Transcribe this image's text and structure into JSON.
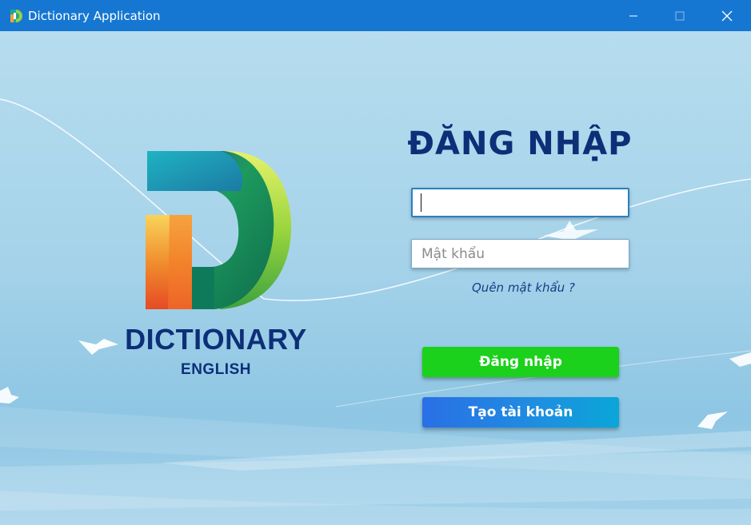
{
  "window": {
    "title": "Dictionary Application",
    "icons": {
      "app": "dictionary-d-logo-icon",
      "minimize": "minimize-icon",
      "maximize": "maximize-icon",
      "close": "close-icon"
    }
  },
  "brand": {
    "name": "DICTIONARY",
    "subtitle": "ENGLISH",
    "logo_icon": "dictionary-d-logo-icon"
  },
  "login": {
    "heading": "ĐĂNG NHẬP",
    "username": {
      "value": "",
      "placeholder": ""
    },
    "password": {
      "value": "",
      "placeholder": "Mật khẩu"
    },
    "forgot_link": "Quên mật khẩu ?",
    "login_button": "Đăng nhập",
    "register_button": "Tạo tài khoản"
  },
  "colors": {
    "titlebar": "#1677d2",
    "heading": "#0d2f78",
    "login_button": "#1bd11b",
    "register_button": "#2a6fe6"
  }
}
